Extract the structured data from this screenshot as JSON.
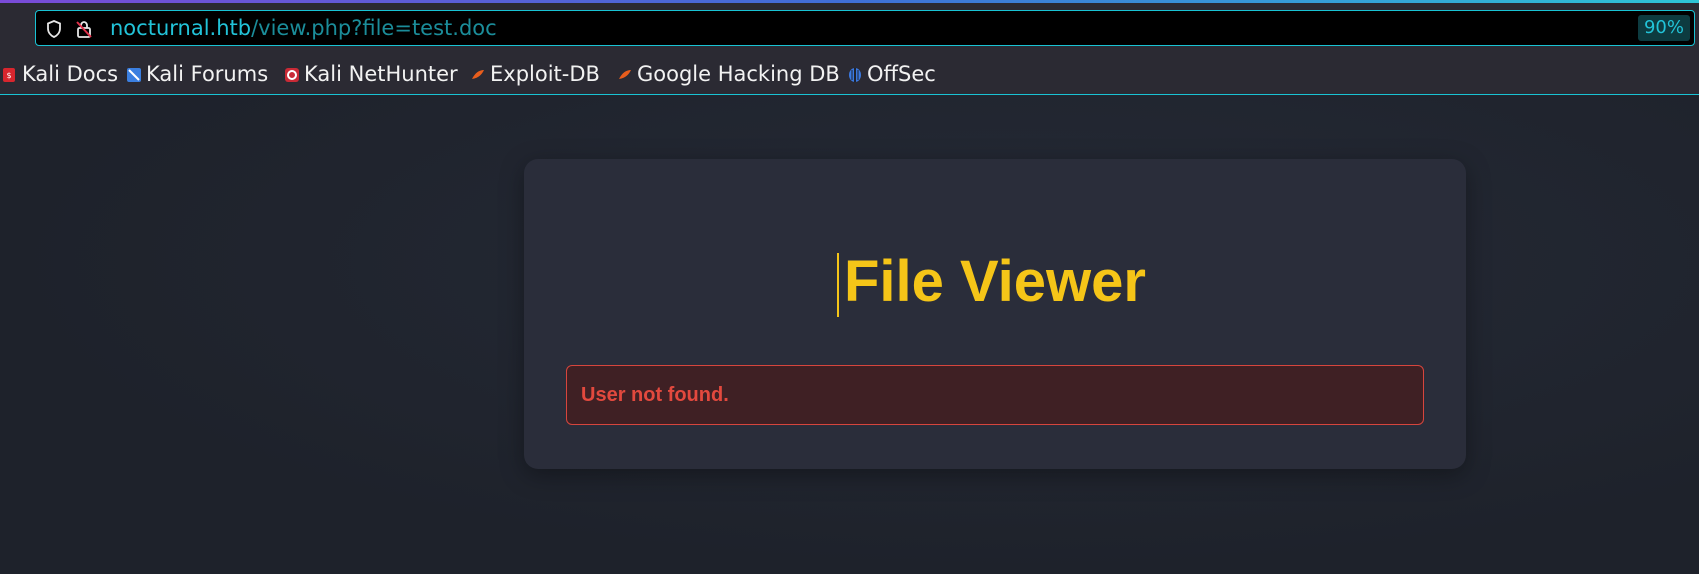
{
  "browser": {
    "url_host": "nocturnal.htb",
    "url_path": "/view.php?file=test.doc",
    "zoom": "90%"
  },
  "bookmarks": [
    {
      "label": "Kali Docs",
      "icon": "kali-docs-icon"
    },
    {
      "label": "Kali Forums",
      "icon": "kali-forums-icon"
    },
    {
      "label": "Kali NetHunter",
      "icon": "kali-nethunter-icon"
    },
    {
      "label": "Exploit-DB",
      "icon": "exploit-db-icon"
    },
    {
      "label": "Google Hacking DB",
      "icon": "google-hacking-db-icon"
    },
    {
      "label": "OffSec",
      "icon": "offsec-icon"
    }
  ],
  "page": {
    "title": "File Viewer",
    "error_message": "User not found."
  },
  "colors": {
    "accent": "#19c3d4",
    "title": "#f5c518",
    "error_text": "#e2493e",
    "error_border": "#d6453d",
    "card_bg": "#2a2d3a",
    "page_bg": "#1f232d"
  }
}
